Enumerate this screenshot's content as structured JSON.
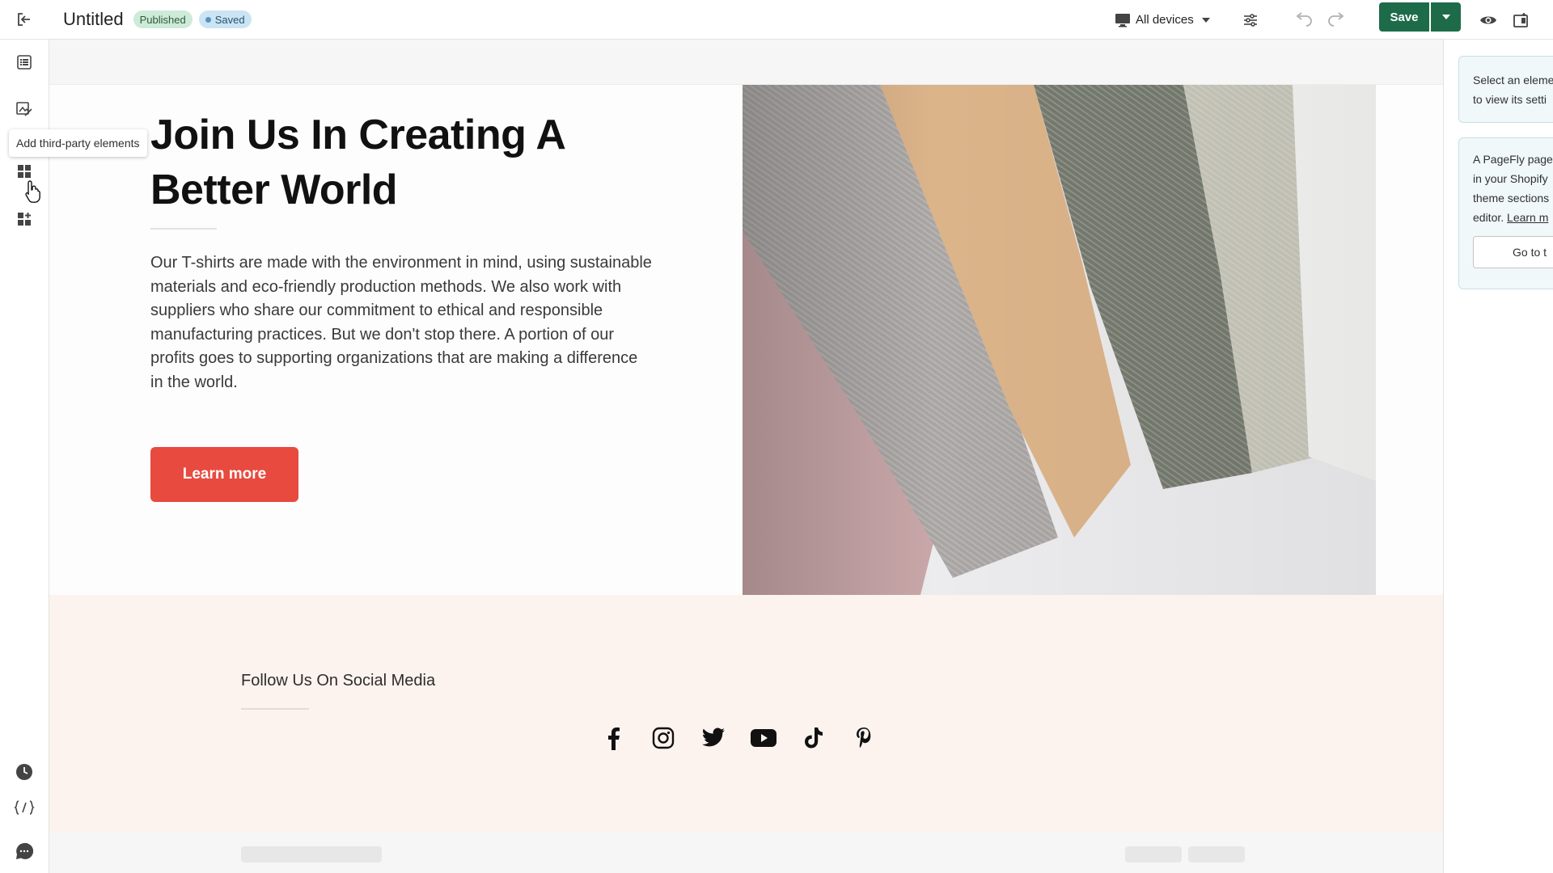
{
  "header": {
    "title": "Untitled",
    "status_published": "Published",
    "status_saved": "Saved",
    "device_label": "All devices",
    "save_label": "Save",
    "icons": {
      "exit": "exit-icon",
      "monitor": "monitor-icon",
      "settings": "sliders-icon",
      "undo": "undo-icon",
      "redo": "redo-icon",
      "preview": "eye-icon",
      "publish": "publish-icon"
    }
  },
  "sidebar": {
    "tooltip": "Add third-party elements",
    "items": [
      {
        "icon": "list-icon"
      },
      {
        "icon": "image-icon"
      },
      {
        "icon": "grid-icon"
      },
      {
        "icon": "add-app-icon"
      },
      {
        "icon": "clock-icon"
      },
      {
        "icon": "code-icon"
      },
      {
        "icon": "chat-icon"
      }
    ]
  },
  "canvas": {
    "hero": {
      "title": "Join Us In Creating A Better World",
      "body": "Our T-shirts are made with the environment in mind, using sustainable materials and eco-friendly production methods. We also work with suppliers who share our commitment to ethical and responsible manufacturing practices. But we don't stop there. A portion of our profits goes to supporting organizations that are making a difference in the world.",
      "button_label": "Learn more"
    },
    "social": {
      "title": "Follow Us On Social Media",
      "icons": [
        "facebook-icon",
        "instagram-icon",
        "twitter-icon",
        "youtube-icon",
        "tiktok-icon",
        "pinterest-icon"
      ]
    }
  },
  "right_panel": {
    "hint_line1": "Select an eleme",
    "hint_line2": "to view its setti",
    "info_line1": "A PageFly page",
    "info_line2": "in your Shopify",
    "info_line3": "theme sections",
    "info_line4_text": "editor.",
    "info_link": "Learn m",
    "button_label": "Go to t"
  },
  "colors": {
    "primary": "#1e6b4a",
    "cta": "#e84a3f",
    "social_bg": "#fcf3ef"
  }
}
